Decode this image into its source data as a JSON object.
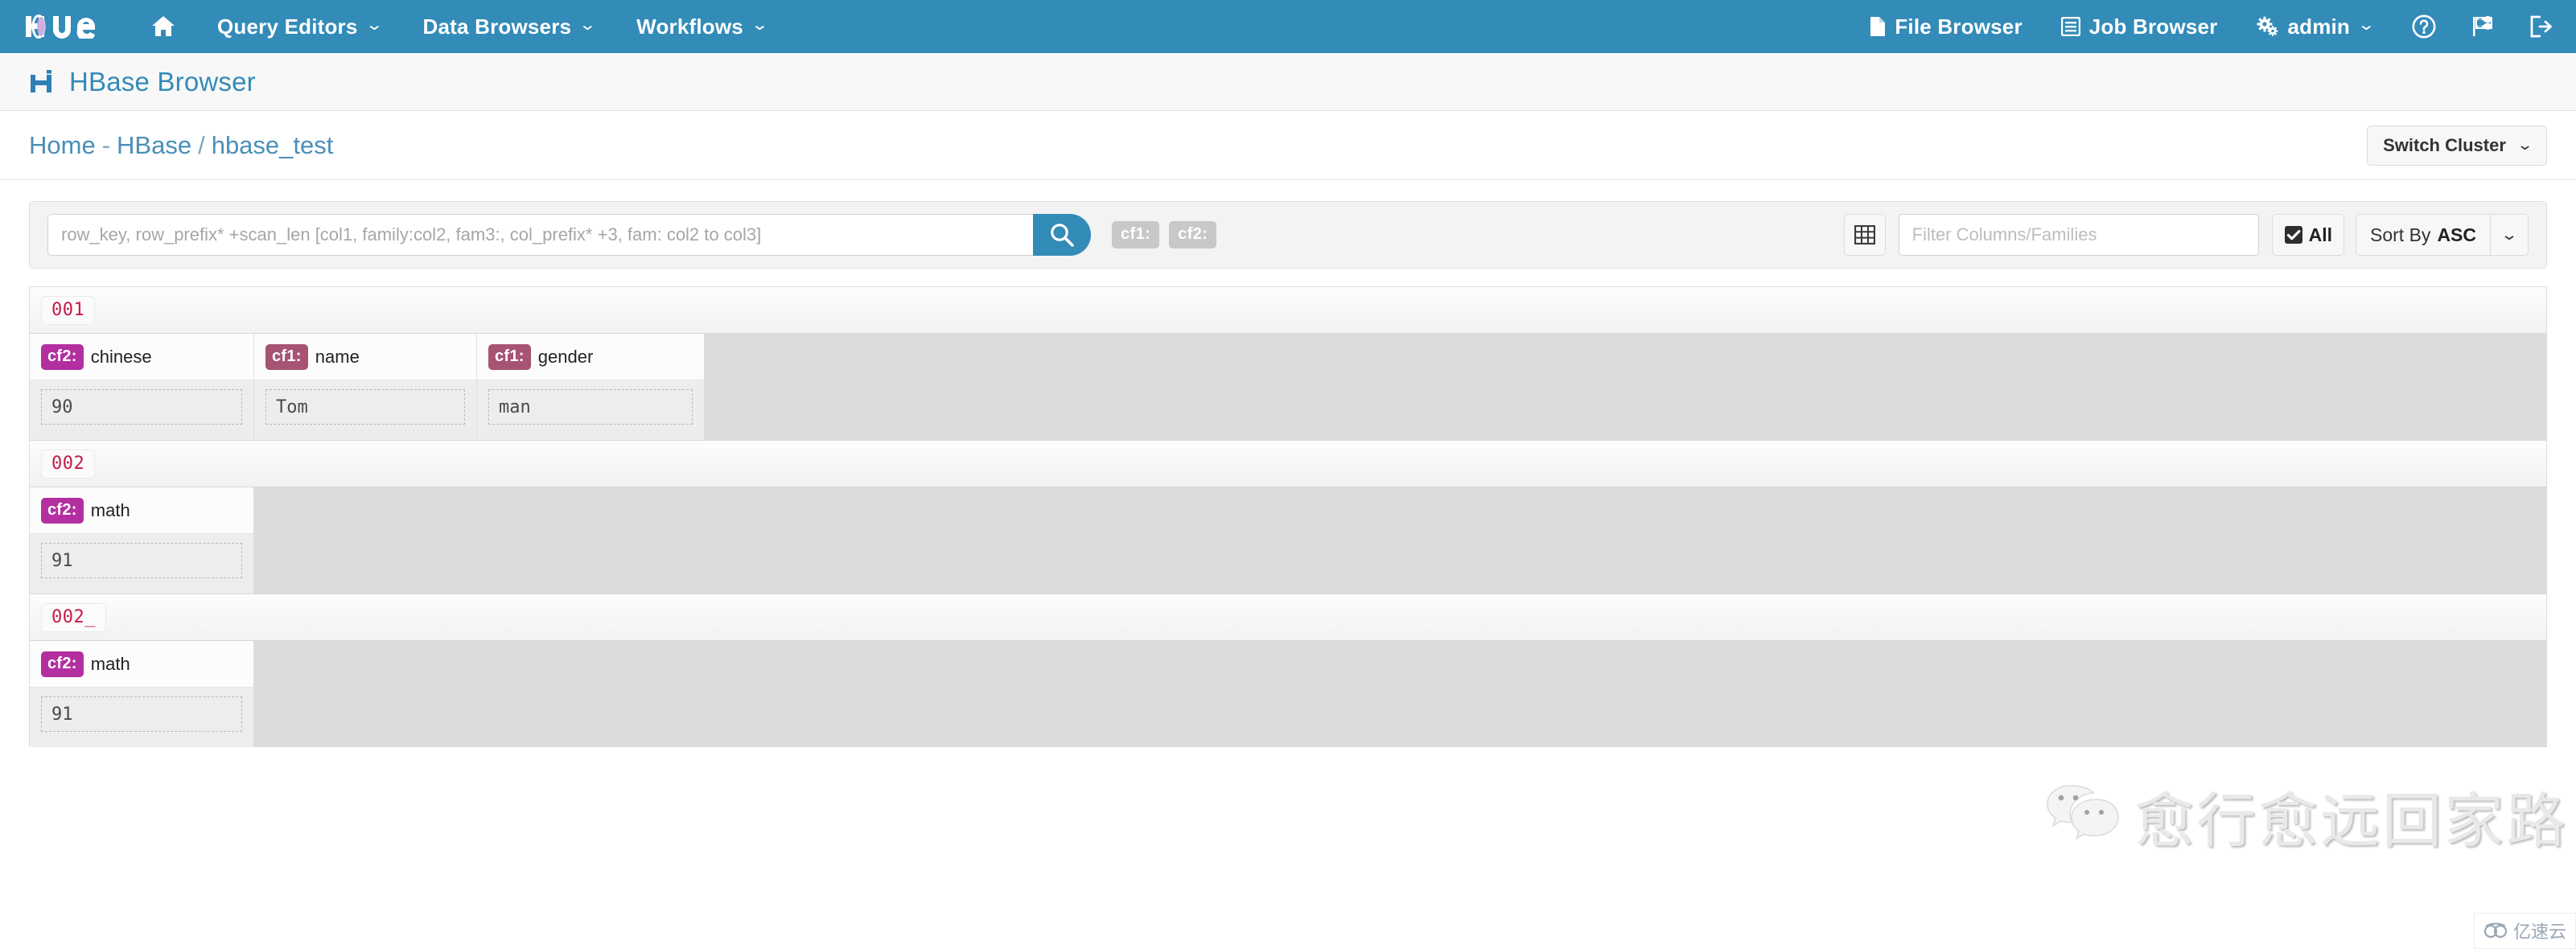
{
  "colors": {
    "navbar_blue": "#338bb8",
    "accent_blue": "#4a8fb8",
    "rowkey_crimson": "#c51a4a",
    "cf1_badge": "#a65374",
    "cf2_badge": "#b32fa0",
    "tag_gray": "#c8c8c8"
  },
  "navbar": {
    "brand": "hue",
    "home_icon": "home-icon",
    "left_items": [
      {
        "label": "Query Editors",
        "caret": "⌄",
        "icon": ""
      },
      {
        "label": "Data Browsers",
        "caret": "⌄",
        "icon": ""
      },
      {
        "label": "Workflows",
        "caret": "⌄",
        "icon": ""
      }
    ],
    "right_items": [
      {
        "label": "File Browser",
        "icon": "file-icon",
        "caret": ""
      },
      {
        "label": "Job Browser",
        "icon": "list-icon",
        "caret": ""
      },
      {
        "label": "admin",
        "icon": "gears-icon",
        "caret": "⌄"
      }
    ],
    "right_icons": [
      {
        "name": "help-icon"
      },
      {
        "name": "flag-icon"
      },
      {
        "name": "logout-icon"
      }
    ]
  },
  "page": {
    "title": "HBase Browser",
    "title_icon": "hbase-logo-icon"
  },
  "breadcrumb": {
    "home": "Home",
    "dash": "-",
    "cluster": "HBase",
    "slash": "/",
    "table": "hbase_test"
  },
  "switch_cluster": {
    "label": "Switch Cluster",
    "caret": "⌄"
  },
  "toolbar": {
    "search": {
      "value": "",
      "placeholder": "row_key, row_prefix* +scan_len [col1, family:col2, fam3:, col_prefix* +3, fam: col2 to col3]",
      "button_icon": "search-icon"
    },
    "cf_tags": [
      "cf1:",
      "cf2:"
    ],
    "grid_button_icon": "table-grid-icon",
    "filter": {
      "value": "",
      "placeholder": "Filter Columns/Families"
    },
    "all_button": {
      "label": "All",
      "checked": true,
      "icon": "checkbox-checked-icon"
    },
    "sort": {
      "label": "Sort By",
      "direction": "ASC",
      "caret": "⌄"
    }
  },
  "results": {
    "rows": [
      {
        "row_key": "001",
        "columns": [
          {
            "family": "cf2:",
            "family_class": "cf2",
            "qualifier": "chinese",
            "value": "90"
          },
          {
            "family": "cf1:",
            "family_class": "cf1",
            "qualifier": "name",
            "value": "Tom"
          },
          {
            "family": "cf1:",
            "family_class": "cf1",
            "qualifier": "gender",
            "value": "man"
          }
        ]
      },
      {
        "row_key": "002",
        "columns": [
          {
            "family": "cf2:",
            "family_class": "cf2",
            "qualifier": "math",
            "value": "91"
          }
        ]
      },
      {
        "row_key": "002_",
        "columns": [
          {
            "family": "cf2:",
            "family_class": "cf2",
            "qualifier": "math",
            "value": "91"
          }
        ]
      }
    ]
  },
  "watermark": {
    "text": "愈行愈远回家路",
    "icon": "wechat-icon"
  },
  "brand_badge": {
    "text": "亿速云",
    "icon": "cloud-icon"
  }
}
